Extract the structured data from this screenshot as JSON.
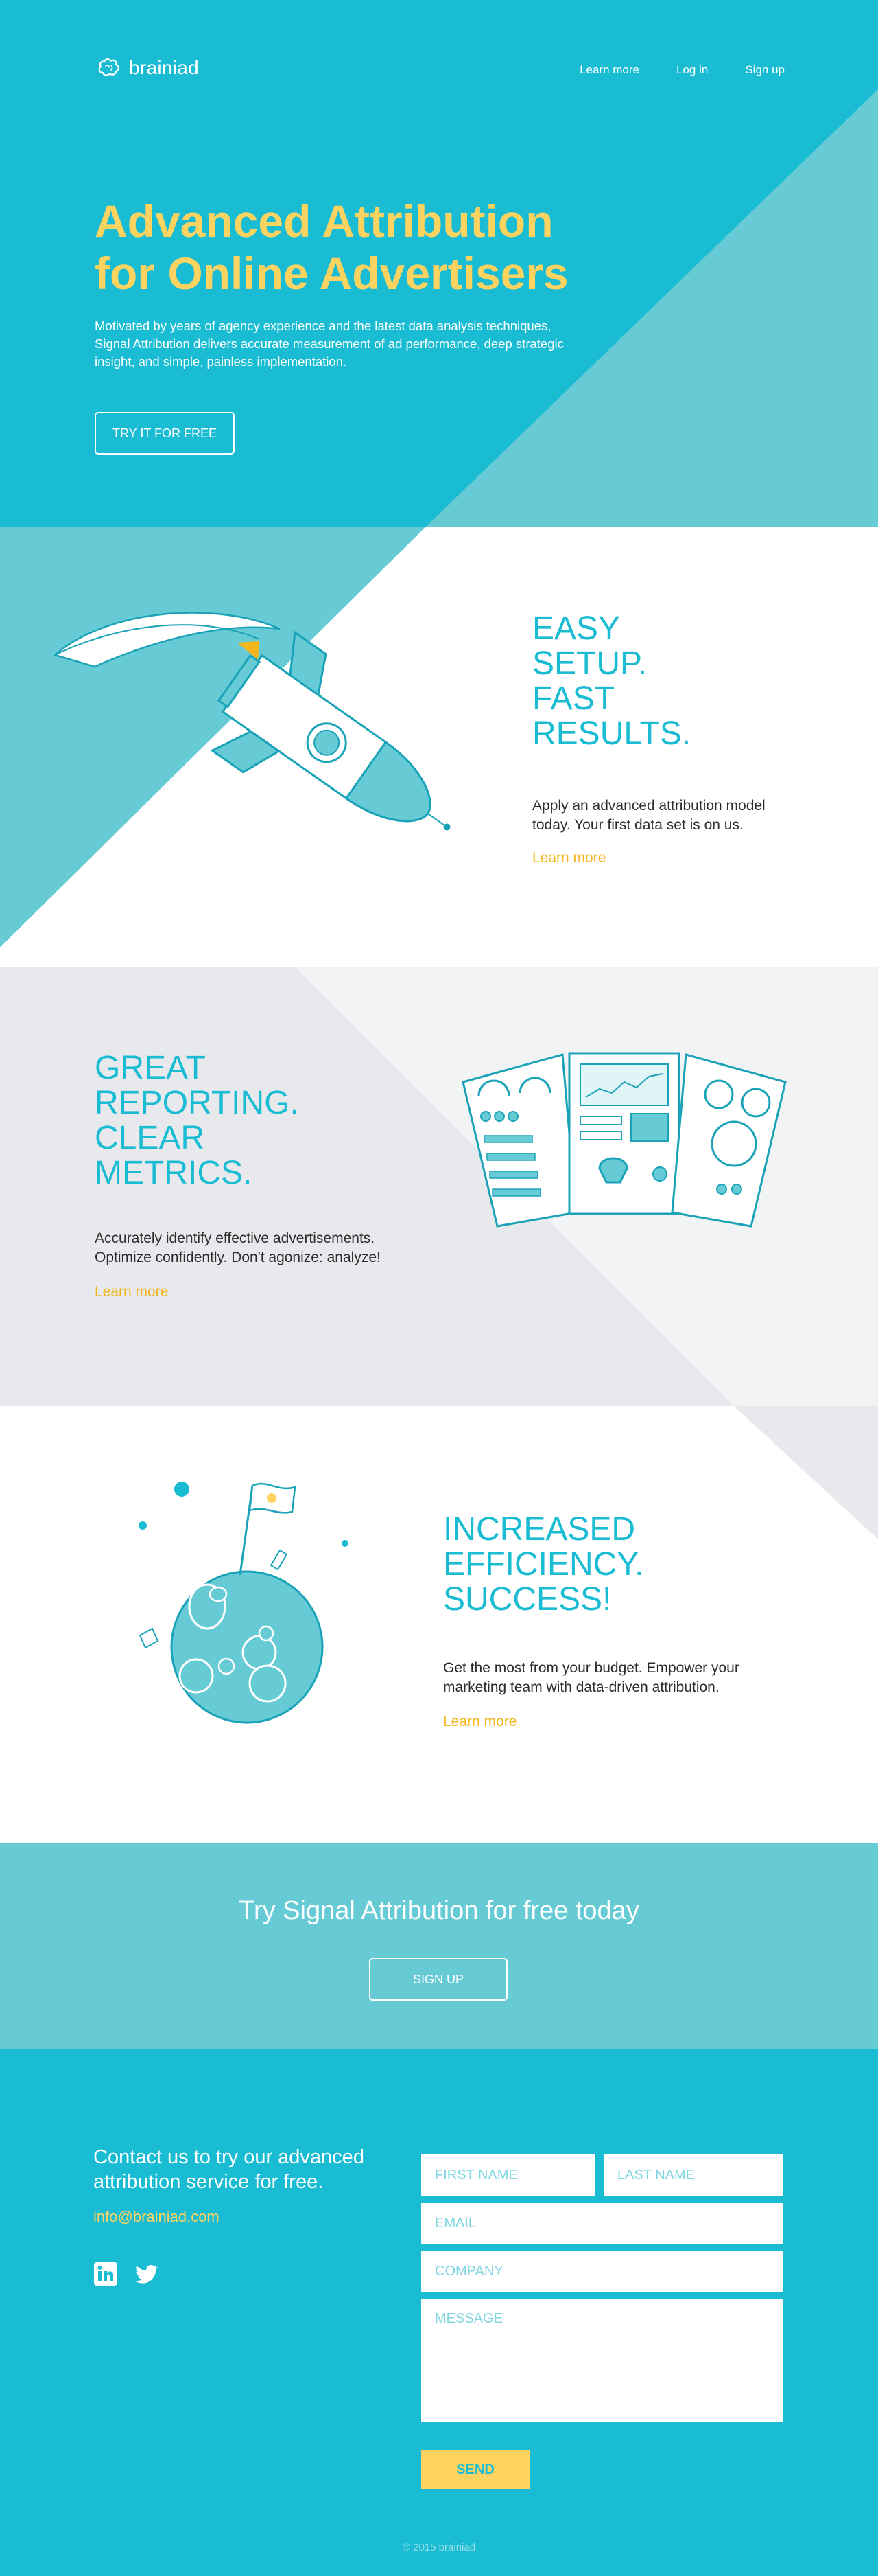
{
  "brand": {
    "name": "brainiad"
  },
  "nav": {
    "items": [
      "Learn more",
      "Log in",
      "Sign up"
    ]
  },
  "hero": {
    "title_line1": "Advanced Attribution",
    "title_line2": "for Online Advertisers",
    "text": "Motivated by years of agency experience and the latest data analysis techniques, Signal Attribution delivers accurate measurement of ad performance, deep strategic insight, and simple, painless implementation.",
    "cta_label": "TRY IT FOR FREE"
  },
  "features": [
    {
      "heading_lines": [
        "EASY",
        "SETUP.",
        "FAST",
        "RESULTS."
      ],
      "text": "Apply an advanced attribution model today. Your first data set is on us.",
      "link": "Learn more"
    },
    {
      "heading_lines": [
        "GREAT",
        "REPORTING.",
        "CLEAR",
        "METRICS."
      ],
      "text": "Accurately identify effective advertisements. Optimize confidently. Don't agonize: analyze!",
      "link": "Learn more"
    },
    {
      "heading_lines": [
        "INCREASED",
        "EFFICIENCY.",
        "SUCCESS!"
      ],
      "text": "Get the most from your budget. Empower your marketing team with data-driven attribution.",
      "link": "Learn more"
    }
  ],
  "cta": {
    "title": "Try Signal Attribution for free today",
    "button": "SIGN UP"
  },
  "contact": {
    "title": "Contact us to try our advanced attribution service for free.",
    "email": "info@brainiad.com",
    "social": [
      "linkedin-icon",
      "twitter-icon"
    ],
    "form": {
      "first_name": "FIRST NAME",
      "last_name": "LAST NAME",
      "email": "EMAIL",
      "company": "COMPANY",
      "message": "MESSAGE",
      "send": "SEND"
    }
  },
  "footer": {
    "copyright": "© 2015 brainiad"
  },
  "colors": {
    "primary": "#1abcd3",
    "light_teal": "#66cbd4",
    "accent": "#fed35f",
    "grey_bg": "#f2f3f5"
  }
}
